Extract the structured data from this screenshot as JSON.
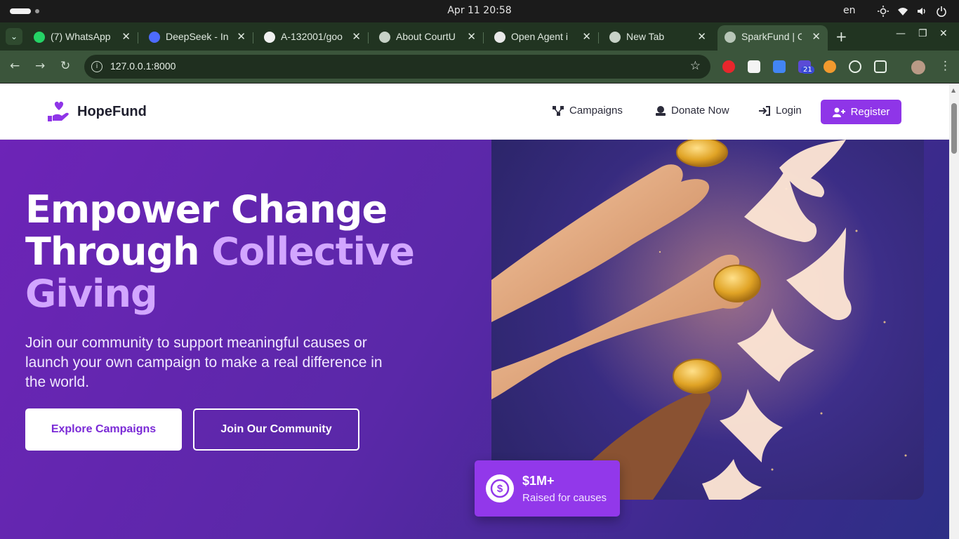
{
  "os": {
    "clock": "Apr 11  20:58",
    "lang": "en"
  },
  "tabs": [
    {
      "title": "(7) WhatsApp",
      "icon": "whatsapp-icon"
    },
    {
      "title": "DeepSeek - In",
      "icon": "deepseek-icon"
    },
    {
      "title": "A-132001/goo",
      "icon": "github-icon"
    },
    {
      "title": "About CourtU",
      "icon": "globe-icon"
    },
    {
      "title": "Open Agent i",
      "icon": "openai-icon"
    },
    {
      "title": "New Tab",
      "icon": "chrome-icon"
    },
    {
      "title": "SparkFund | C",
      "icon": "globe-icon"
    }
  ],
  "address": {
    "url": "127.0.0.1:8000"
  },
  "extensions": {
    "badge": "21"
  },
  "site": {
    "brand": "HopeFund",
    "nav": {
      "campaigns": "Campaigns",
      "donate": "Donate Now",
      "login": "Login",
      "register": "Register"
    }
  },
  "hero": {
    "title_line1": "Empower Change",
    "title_line2a": "Through ",
    "title_line2b": "Collective",
    "title_line3": "Giving",
    "lead": "Join our community to support meaningful causes or launch your own campaign to make a real difference in the world.",
    "cta_primary": "Explore Campaigns",
    "cta_secondary": "Join Our Community",
    "stat_value": "$1M+",
    "stat_label": "Raised for causes"
  },
  "colors": {
    "brand": "#8f35e8",
    "accent_text": "#d2a6ff",
    "hero_start": "#6d24b7",
    "hero_end": "#2d2f86"
  }
}
